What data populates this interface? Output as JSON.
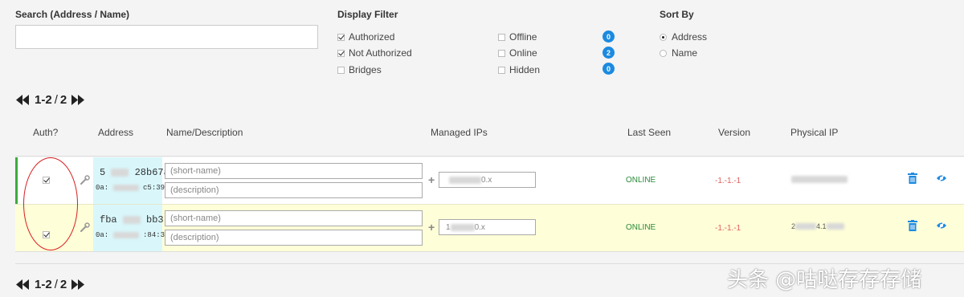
{
  "search": {
    "label": "Search (Address / Name)",
    "value": "",
    "placeholder": ""
  },
  "display_filter": {
    "label": "Display Filter",
    "options": [
      {
        "label": "Authorized",
        "checked": true
      },
      {
        "label": "Not Authorized",
        "checked": true
      },
      {
        "label": "Bridges",
        "checked": false
      },
      {
        "label": "Offline",
        "checked": false,
        "count": "0"
      },
      {
        "label": "Online",
        "checked": false,
        "count": "2"
      },
      {
        "label": "Hidden",
        "checked": false,
        "count": "0"
      }
    ]
  },
  "sort_by": {
    "label": "Sort By",
    "options": [
      {
        "label": "Address",
        "selected": true
      },
      {
        "label": "Name",
        "selected": false
      }
    ]
  },
  "pagination": {
    "range": "1-2",
    "separator": "/",
    "total": "2"
  },
  "table": {
    "headers": {
      "auth": "Auth?",
      "address": "Address",
      "name": "Name/Description",
      "managed_ips": "Managed IPs",
      "last_seen": "Last Seen",
      "version": "Version",
      "physical_ip": "Physical IP"
    },
    "rows": [
      {
        "authorized": true,
        "address_a": "5",
        "address_b": "28b67a",
        "mac_a": "0a:",
        "mac_b": "c5:39:f",
        "name_placeholder": "(short-name)",
        "desc_placeholder": "(description)",
        "ip_suffix": "0.x",
        "status": "ONLINE",
        "version": "-1.-1.-1",
        "physical_ip": ""
      },
      {
        "authorized": true,
        "address_a": "fba",
        "address_b": "bb3",
        "mac_a": "0a:",
        "mac_b": ":84:3",
        "name_placeholder": "(short-name)",
        "desc_placeholder": "(description)",
        "ip_prefix": "1",
        "ip_suffix": "0.x",
        "status": "ONLINE",
        "version": "-1.-1.-1",
        "physical_ip_a": "2",
        "physical_ip_b": "4.1"
      }
    ]
  },
  "watermark": "头条 @咕哒存存存储",
  "colors": {
    "accent": "#1c8ae0",
    "online": "#2a8a3a",
    "version": "#e06060",
    "authorized_bar": "#3cab3c",
    "address_bg": "#d9f7fb",
    "row_highlight": "#fefed8",
    "annotation": "#d81e1e"
  }
}
